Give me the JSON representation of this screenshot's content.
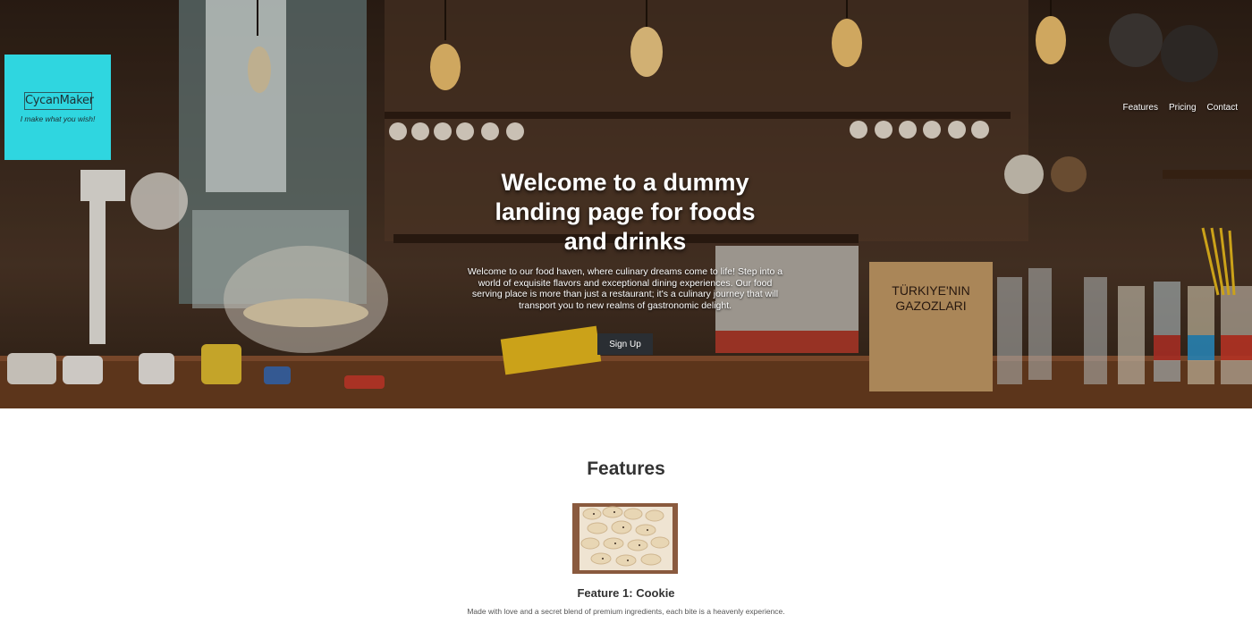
{
  "brand": {
    "name": "CycanMaker",
    "tagline": "I make what you wish!",
    "accent_color": "#2fd6e0"
  },
  "nav": {
    "items": [
      "Features",
      "Pricing",
      "Contact"
    ]
  },
  "hero": {
    "title": "Welcome to a dummy landing page for foods and drinks",
    "text": "Welcome to our food haven, where culinary dreams come to life! Step into a world of exquisite flavors and exceptional dining experiences. Our food serving place is more than just a restaurant; it's a culinary journey that will transport you to new realms of gastronomic delight.",
    "cta_label": "Sign Up",
    "background_image": "restaurant-bar-counter-photo"
  },
  "features": {
    "heading": "Features",
    "items": [
      {
        "image": "cookie-tray-photo",
        "title": "Feature 1: Cookie",
        "description": "Made with love and a secret blend of premium ingredients, each bite is a heavenly experience."
      }
    ]
  }
}
